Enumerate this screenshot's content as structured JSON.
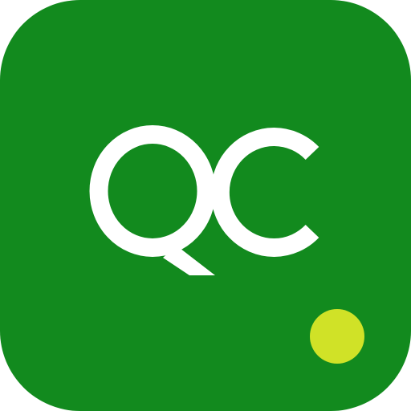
{
  "icon": {
    "monogram": "QC",
    "colors": {
      "background": "#128A1E",
      "letters": "#FFFFFF",
      "dot": "#D0E227"
    }
  }
}
